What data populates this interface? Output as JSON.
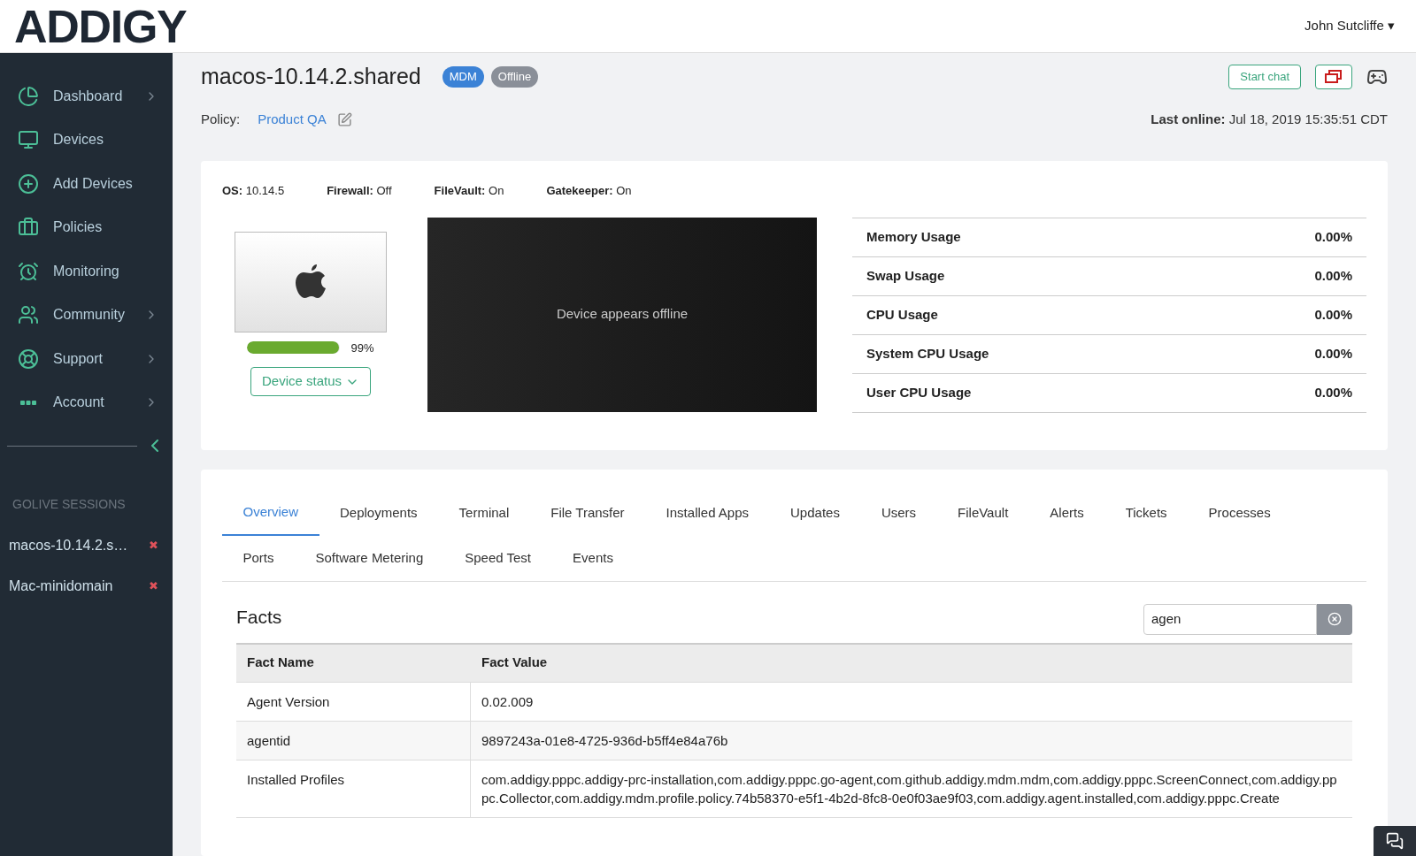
{
  "logo": "ADDIGY",
  "user": {
    "name": "John Sutcliffe",
    "caret": "▾"
  },
  "sidebar": {
    "items": [
      {
        "label": "Dashboard",
        "has_children": true,
        "selected": false
      },
      {
        "label": "Devices",
        "has_children": false,
        "selected": false
      },
      {
        "label": "Add Devices",
        "has_children": false,
        "selected": false
      },
      {
        "label": "Policies",
        "has_children": false,
        "selected": false
      },
      {
        "label": "Monitoring",
        "has_children": false,
        "selected": false
      },
      {
        "label": "Community",
        "has_children": true,
        "selected": false
      },
      {
        "label": "Support",
        "has_children": true,
        "selected": false
      },
      {
        "label": "Account",
        "has_children": true,
        "selected": false
      }
    ],
    "sessions_heading": "GOLIVE SESSIONS",
    "sessions": [
      {
        "name": "macos-10.14.2.s…",
        "close": "✖"
      },
      {
        "name": "Mac-minidomain",
        "close": "✖"
      }
    ]
  },
  "device": {
    "title": "macos-10.14.2.shared",
    "badges": [
      {
        "label": "MDM",
        "color": "#3b82d6"
      },
      {
        "label": "Offline",
        "color": "#8a8f98"
      }
    ],
    "policy_label": "Policy:",
    "policy": "Product QA",
    "last_online_label": "Last online:",
    "last_online": "Jul 18, 2019 15:35:51 CDT",
    "start_chat": "Start chat"
  },
  "summary": {
    "facts": [
      {
        "label": "OS:",
        "value": "10.14.5"
      },
      {
        "label": "Firewall:",
        "value": "Off"
      },
      {
        "label": "FileVault:",
        "value": "On"
      },
      {
        "label": "Gatekeeper:",
        "value": "On"
      }
    ],
    "disk": {
      "level": 0.99,
      "reading": "99%"
    },
    "status_button": "Device status",
    "screen_text": "Device appears offline",
    "usage": [
      {
        "label": "Memory Usage",
        "value": "0.00%"
      },
      {
        "label": "Swap Usage",
        "value": "0.00%"
      },
      {
        "label": "CPU Usage",
        "value": "0.00%"
      },
      {
        "label": "System CPU Usage",
        "value": "0.00%"
      },
      {
        "label": "User CPU Usage",
        "value": "0.00%"
      }
    ]
  },
  "tabs": [
    [
      {
        "label": "Overview",
        "selected": true
      },
      {
        "label": "Deployments",
        "selected": false
      },
      {
        "label": "Terminal",
        "selected": false
      },
      {
        "label": "File Transfer",
        "selected": false
      },
      {
        "label": "Installed Apps",
        "selected": false
      },
      {
        "label": "Updates",
        "selected": false
      },
      {
        "label": "Users",
        "selected": false
      },
      {
        "label": "FileVault",
        "selected": false
      },
      {
        "label": "Alerts",
        "selected": false
      },
      {
        "label": "Tickets",
        "selected": false
      },
      {
        "label": "Processes",
        "selected": false
      }
    ],
    [
      {
        "label": "Ports",
        "selected": false
      },
      {
        "label": "Software Metering",
        "selected": false
      },
      {
        "label": "Speed Test",
        "selected": false
      },
      {
        "label": "Events",
        "selected": false
      }
    ]
  ],
  "facts": {
    "title": "Facts",
    "search": {
      "value": "agen"
    },
    "columns": [
      "Fact Name",
      "Fact Value"
    ],
    "rows": [
      [
        "Agent Version",
        "0.02.009"
      ],
      [
        "agentid",
        "9897243a-01e8-4725-936d-b5ff4e84a76b"
      ],
      [
        "Installed Profiles",
        "com.addigy.pppc.addigy-prc-installation,com.addigy.pppc.go-agent,com.github.addigy.mdm.mdm,com.addigy.pppc.ScreenConnect,com.addigy.pppc.Collector,com.addigy.mdm.profile.policy.74b58370-e5f1-4b2d-8fc8-0e0f03ae9f03,com.addigy.agent.installed,com.addigy.pppc.Create"
      ]
    ]
  }
}
